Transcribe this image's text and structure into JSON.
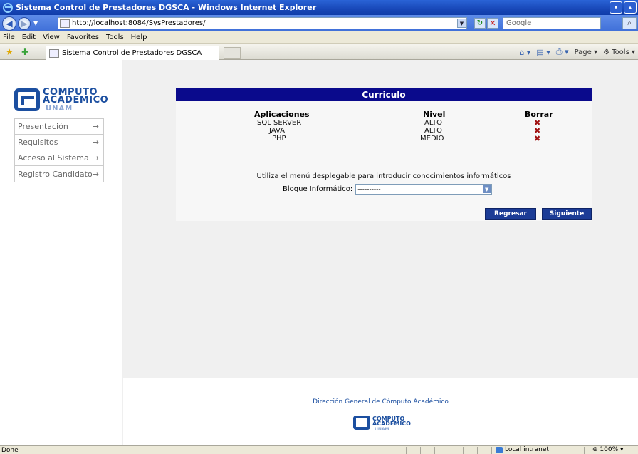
{
  "window": {
    "title": "Sistema Control de Prestadores DGSCA - Windows Internet Explorer"
  },
  "address": {
    "url": "http://localhost:8084/SysPrestadores/",
    "search_placeholder": "Google"
  },
  "menu": [
    "File",
    "Edit",
    "View",
    "Favorites",
    "Tools",
    "Help"
  ],
  "tab": {
    "title": "Sistema Control de Prestadores DGSCA"
  },
  "commandbar": {
    "page": "Page",
    "tools": "Tools"
  },
  "logo": {
    "line1": "COMPUTO",
    "line2": "ACADEMICO",
    "line3": "UNAM"
  },
  "sidebar": {
    "items": [
      {
        "label": "Presentación",
        "arrow": "→"
      },
      {
        "label": "Requisitos",
        "arrow": "→"
      },
      {
        "label": "Acceso al Sistema",
        "arrow": "→"
      },
      {
        "label": "Registro Candidato",
        "arrow": "→"
      }
    ]
  },
  "panel": {
    "title": "Curriculo",
    "columns": {
      "app": "Aplicaciones",
      "level": "Nivel",
      "delete": "Borrar"
    },
    "rows": [
      {
        "app": "SQL SERVER",
        "level": "ALTO"
      },
      {
        "app": "JAVA",
        "level": "ALTO"
      },
      {
        "app": "PHP",
        "level": "MEDIO"
      }
    ],
    "delete_glyph": "✖",
    "info": "Utiliza el menú desplegable para introducir conocimientos informáticos",
    "select_label": "Bloque Informático:",
    "select_value": "----------",
    "back_button": "Regresar",
    "next_button": "Siguiente"
  },
  "footer": {
    "text": "Dirección General de Cómputo Académico",
    "logo1": "COMPUTO",
    "logo2": "ACADEMICO",
    "logo3": "UNAM"
  },
  "status": {
    "left": "Done",
    "zone": "Local intranet",
    "zoom": "100%"
  },
  "colors": {
    "panel_header": "#0a0a8c",
    "button": "#1c3c96",
    "delete": "#a01010",
    "link": "#1c4fa0"
  }
}
